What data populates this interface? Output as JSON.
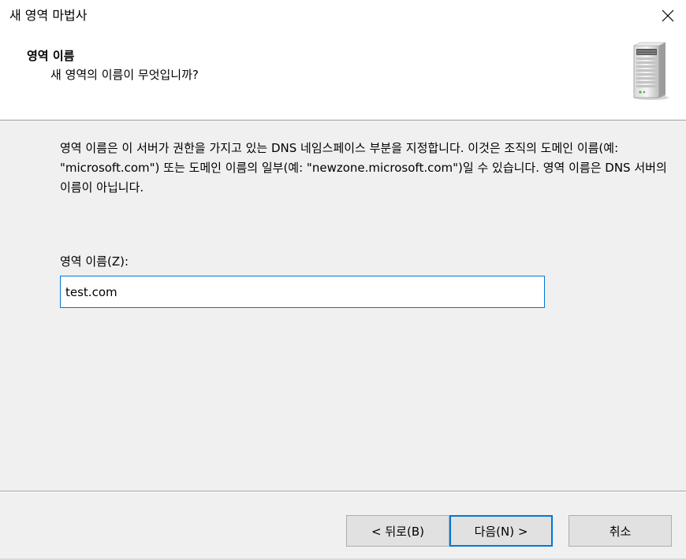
{
  "window": {
    "title": "새 영역 마법사"
  },
  "header": {
    "title": "영역 이름",
    "subtitle": "새 영역의 이름이 무엇입니까?",
    "icon": "server-tower-icon"
  },
  "main": {
    "description": "영역 이름은 이 서버가 권한을 가지고 있는 DNS 네임스페이스 부분을 지정합니다. 이것은 조직의 도메인 이름(예: \"microsoft.com\") 또는 도메인 이름의 일부(예: \"newzone.microsoft.com\")일 수 있습니다. 영역 이름은 DNS 서버의 이름이 아닙니다.",
    "zone_name_label": "영역 이름(Z):",
    "zone_name_value": "test.com"
  },
  "buttons": {
    "back_label": "< 뒤로(B)",
    "next_label": "다음(N) >",
    "cancel_label": "취소"
  },
  "colors": {
    "accent": "#0078d7",
    "dialog_bg": "#f0f0f0",
    "header_bg": "#ffffff",
    "button_bg": "#e1e1e1"
  }
}
